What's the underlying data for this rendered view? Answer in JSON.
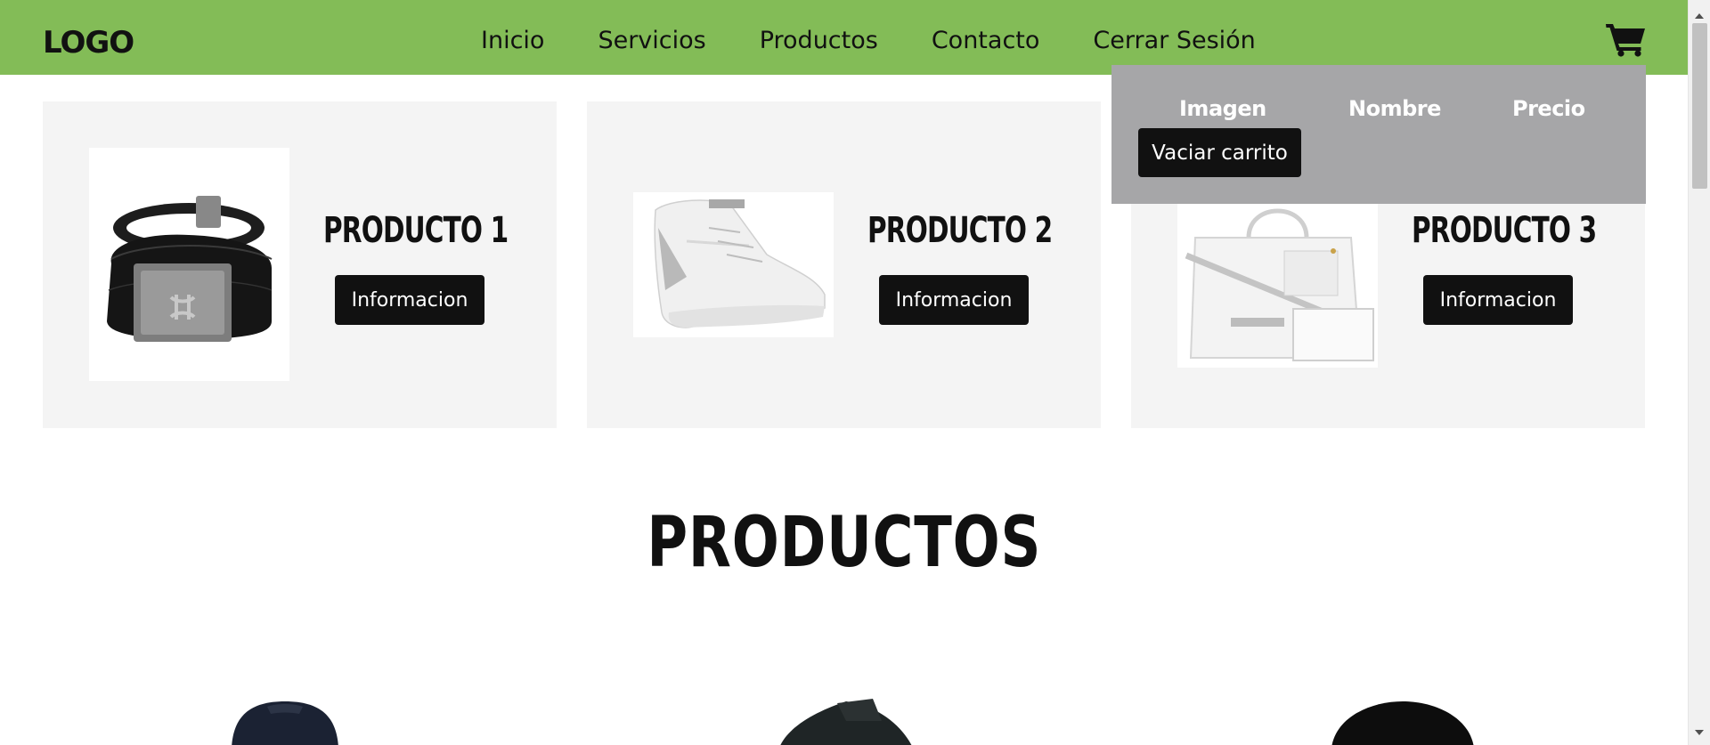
{
  "header": {
    "logo": "LOGO",
    "nav": [
      "Inicio",
      "Servicios",
      "Productos",
      "Contacto",
      "Cerrar Sesión"
    ],
    "cart_icon": "shopping-cart-icon",
    "background": "#83bc57"
  },
  "featured": [
    {
      "title": "PRODUCTO 1",
      "button": "Informacion",
      "image": "belt-image"
    },
    {
      "title": "PRODUCTO 2",
      "button": "Informacion",
      "image": "sneaker-image"
    },
    {
      "title": "PRODUCTO 3",
      "button": "Informacion",
      "image": "bag-image"
    }
  ],
  "products_section": {
    "title": "PRODUCTOS"
  },
  "cart": {
    "headers": [
      "Imagen",
      "Nombre",
      "Precio"
    ],
    "empty_button": "Vaciar carrito",
    "background": "#a6a6a8"
  }
}
